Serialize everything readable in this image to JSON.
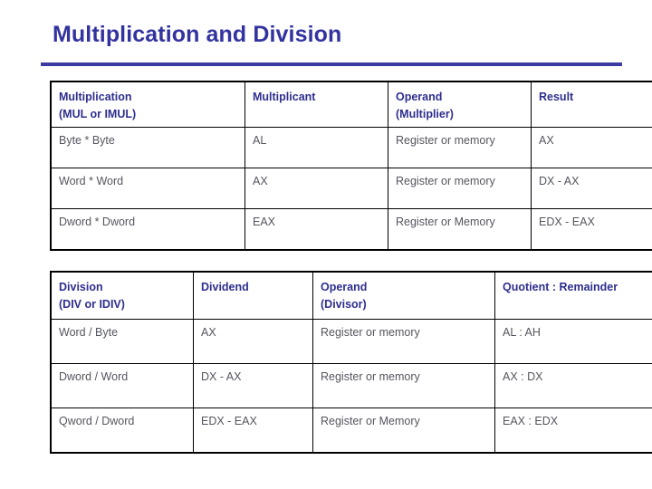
{
  "slide": {
    "title": "Multiplication and Division"
  },
  "multiplication_table": {
    "headers": [
      {
        "line1": "Multiplication",
        "line2": "(MUL or IMUL)"
      },
      {
        "line1": "Multiplicant",
        "line2": ""
      },
      {
        "line1": "Operand",
        "line2": "(Multiplier)"
      },
      {
        "line1": "Result",
        "line2": ""
      }
    ],
    "rows": [
      [
        "Byte * Byte",
        "AL",
        "Register or memory",
        "AX"
      ],
      [
        "Word * Word",
        "AX",
        "Register or memory",
        "DX - AX"
      ],
      [
        "Dword * Dword",
        "EAX",
        "Register or Memory",
        "EDX - EAX"
      ]
    ]
  },
  "division_table": {
    "headers": [
      {
        "line1": "Division",
        "line2": "(DIV or IDIV)"
      },
      {
        "line1": "Dividend",
        "line2": ""
      },
      {
        "line1": "Operand",
        "line2": "(Divisor)"
      },
      {
        "line1": "Quotient : Remainder",
        "line2": ""
      }
    ],
    "rows": [
      [
        "Word / Byte",
        "AX",
        "Register or memory",
        "AL : AH"
      ],
      [
        "Dword / Word",
        "DX - AX",
        "Register or memory",
        "AX : DX"
      ],
      [
        "Qword / Dword",
        "EDX - EAX",
        "Register or Memory",
        "EAX : EDX"
      ]
    ]
  },
  "colors": {
    "title": "#3333a0",
    "rule": "#3b3ba0",
    "table_header_text": "#2e2e8f",
    "table_body_text": "#55555f",
    "table_border": "#000000"
  }
}
